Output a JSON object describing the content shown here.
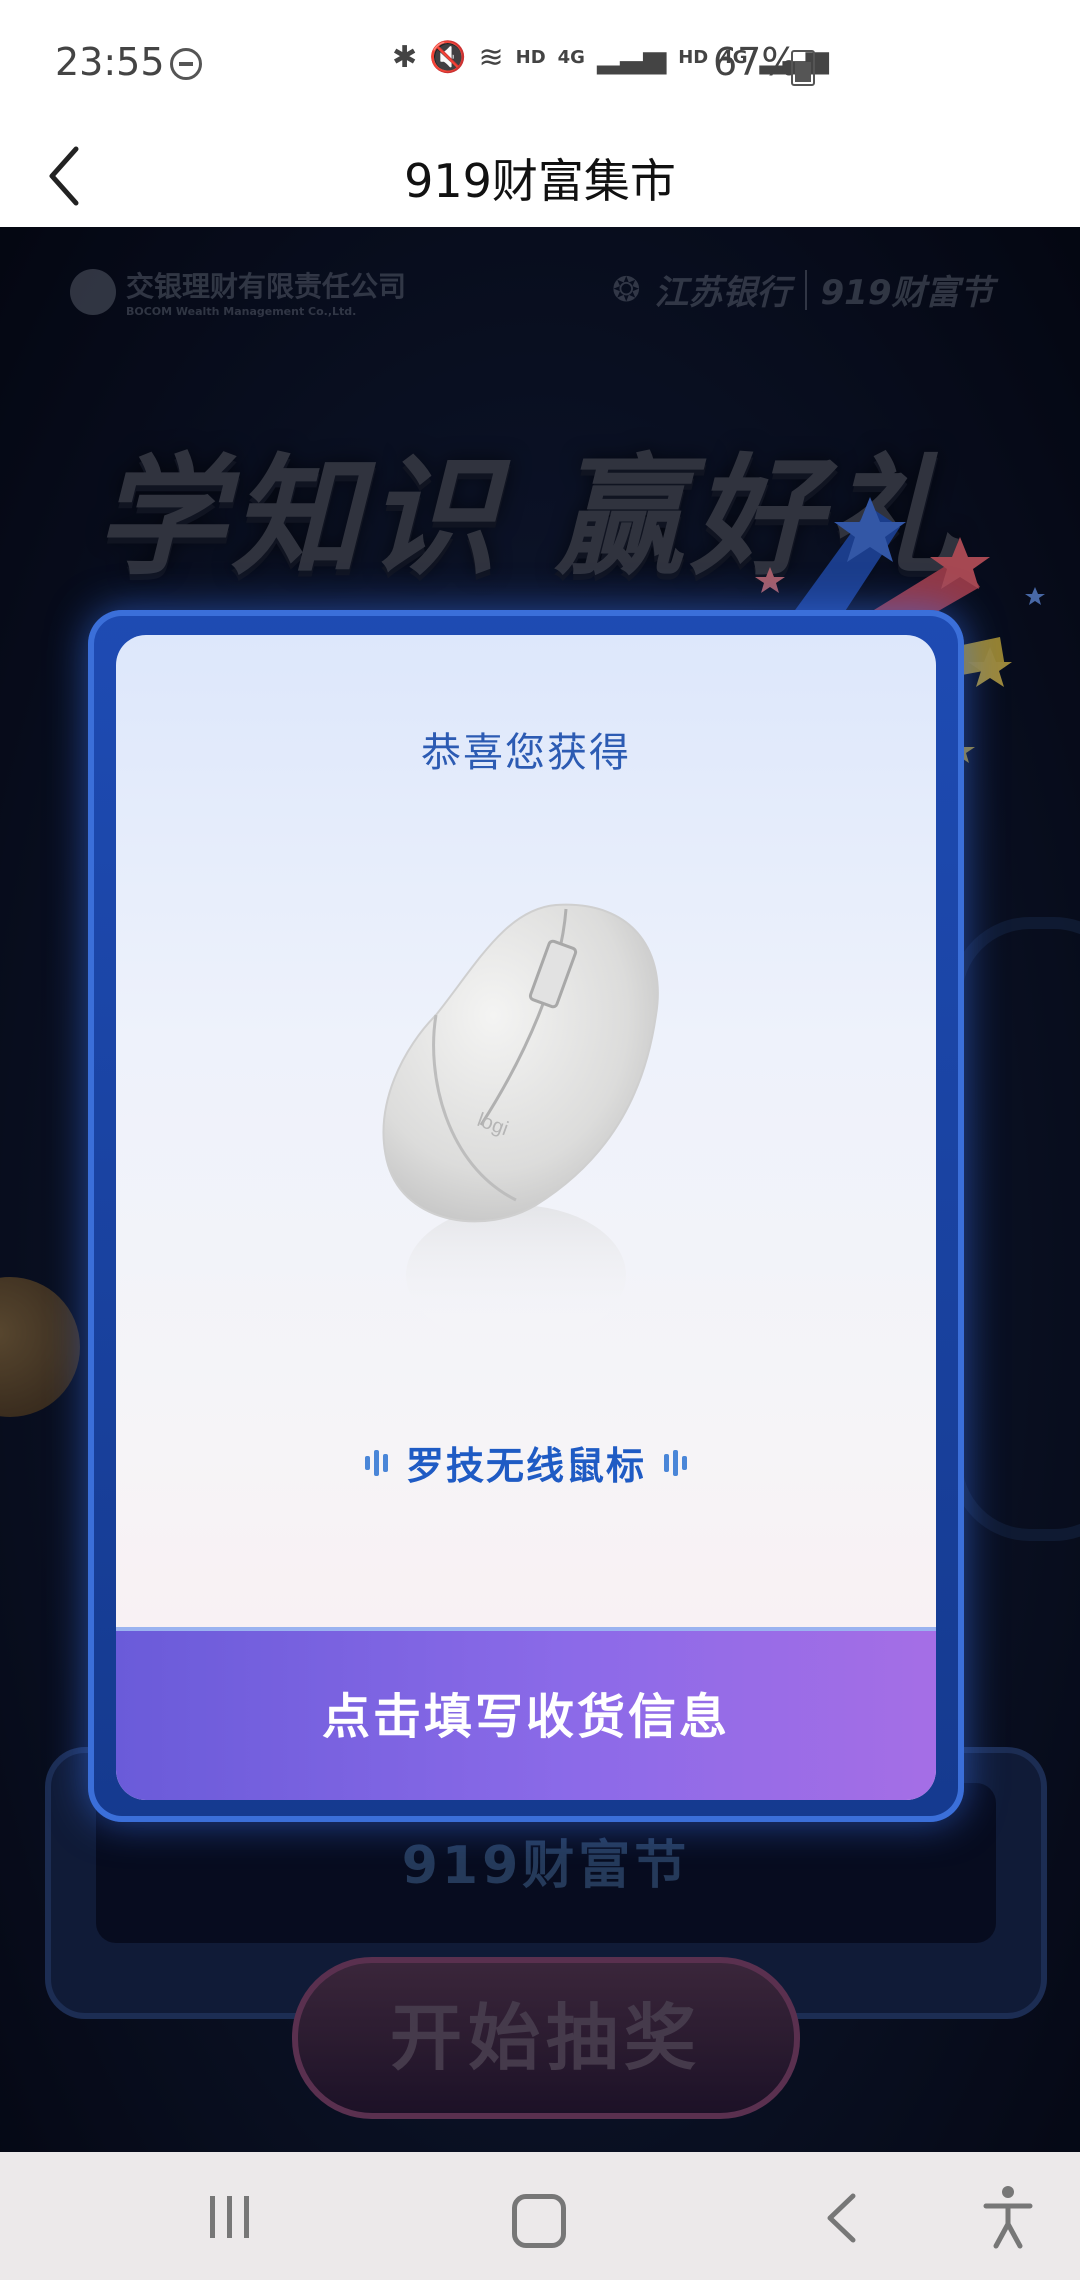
{
  "status_bar": {
    "time": "23:55",
    "network_label": "4G",
    "hd_label": "HD",
    "battery_percent": "67%"
  },
  "nav": {
    "title": "919财富集市"
  },
  "background": {
    "brand_left_name": "交银理财有限责任公司",
    "brand_left_sub": "BOCOM Wealth Management Co.,Ltd.",
    "brand_right_bank": "江苏银行",
    "brand_right_event": "919财富节",
    "headline": "学知识 赢好礼",
    "stage_label": "919财富节",
    "start_button": "开始抽奖"
  },
  "modal": {
    "title": "恭喜您获得",
    "prize_name": "罗技无线鼠标",
    "mouse_logo": "logi",
    "cta_label": "点击填写收货信息",
    "accent_color": "#1f5bc4",
    "cta_color": "#8b6ae8"
  },
  "system_nav": {
    "recent_icon": "recent-apps-icon",
    "home_icon": "home-icon",
    "back_icon": "back-icon",
    "accessibility_icon": "accessibility-icon"
  }
}
